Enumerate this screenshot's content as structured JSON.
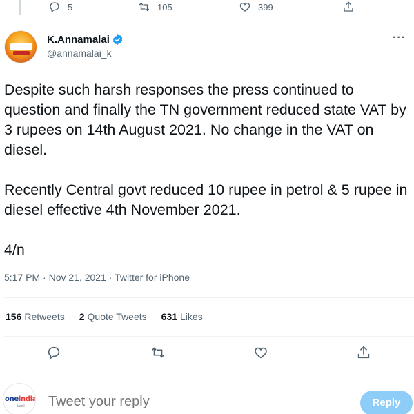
{
  "previous_tweet": {
    "reply_count": "5",
    "retweet_count": "105",
    "like_count": "399",
    "icons": [
      "reply-icon",
      "retweet-icon",
      "like-icon",
      "share-icon"
    ]
  },
  "author": {
    "display_name": "K.Annamalai",
    "handle": "@annamalai_k",
    "verified_icon": "verified-badge-icon",
    "more_label": "···"
  },
  "tweet": {
    "paragraphs": [
      "Despite such harsh responses the press continued to question and finally the TN government reduced state VAT by 3 rupees on 14th August 2021. No change in the VAT on diesel.",
      "Recently Central govt  reduced 10 rupee in petrol & 5 rupee in diesel effective 4th November 2021.",
      "4/n"
    ],
    "timestamp": "5:17 PM · Nov 21, 2021 · Twitter for iPhone"
  },
  "stats": {
    "retweets_count": "156",
    "retweets_label": "Retweets",
    "quotes_count": "2",
    "quotes_label": "Quote Tweets",
    "likes_count": "631",
    "likes_label": "Likes"
  },
  "reply": {
    "avatar_brand_blue": "one",
    "avatar_brand_red": "india",
    "avatar_sub": "tamil",
    "placeholder": "Tweet your reply",
    "button_label": "Reply"
  },
  "colors": {
    "accent": "#1d9bf0",
    "reply_button_disabled": "#8ecdf8",
    "secondary_text": "#536471"
  }
}
